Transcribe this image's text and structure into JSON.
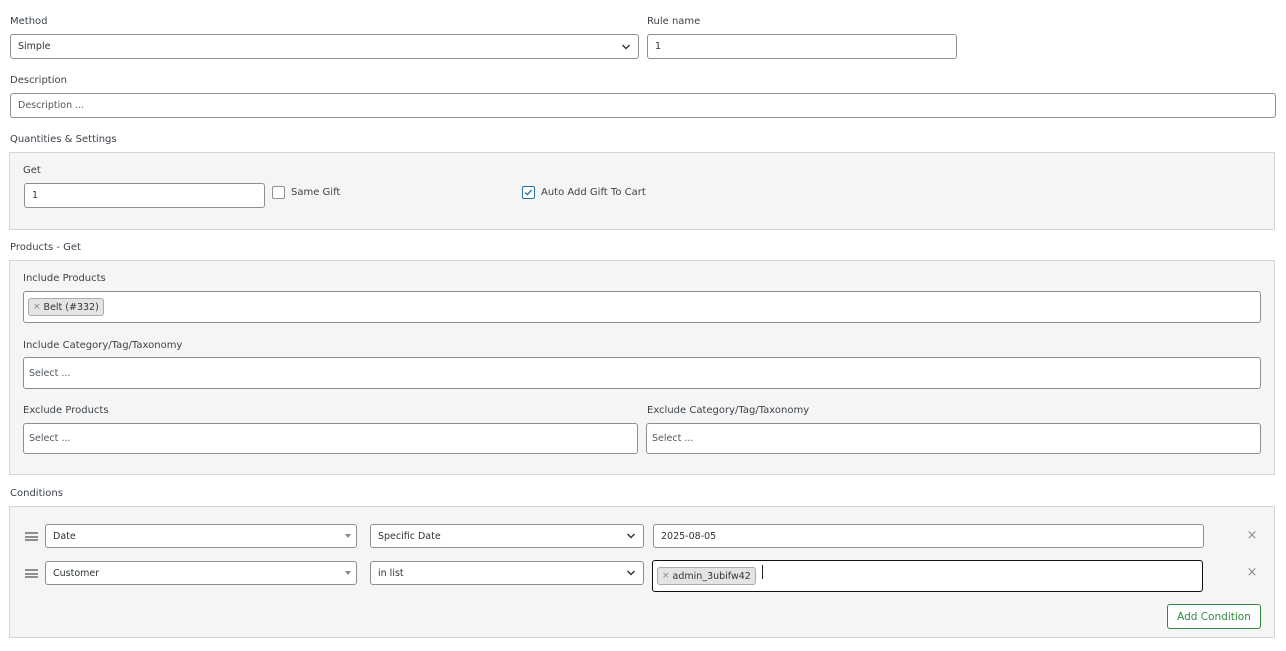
{
  "method": {
    "label": "Method",
    "value": "Simple"
  },
  "rule_name": {
    "label": "Rule name",
    "value": "1"
  },
  "description": {
    "label": "Description",
    "placeholder": "Description ..."
  },
  "quantities": {
    "label": "Quantities & Settings",
    "get_label": "Get",
    "get_value": "1",
    "same_gift_label": "Same Gift",
    "same_gift_checked": false,
    "auto_add_label": "Auto Add Gift To Cart",
    "auto_add_checked": true
  },
  "products_get": {
    "label": "Products - Get",
    "include_products_label": "Include Products",
    "include_products_tags": [
      "Belt (#332)"
    ],
    "include_category_label": "Include Category/Tag/Taxonomy",
    "include_category_placeholder": "Select ...",
    "exclude_products_label": "Exclude Products",
    "exclude_products_placeholder": "Select ...",
    "exclude_category_label": "Exclude Category/Tag/Taxonomy",
    "exclude_category_placeholder": "Select ..."
  },
  "conditions": {
    "label": "Conditions",
    "rows": [
      {
        "type": "Date",
        "operator": "Specific Date",
        "value": "2025-08-05"
      },
      {
        "type": "Customer",
        "operator": "in list",
        "tag": "admin_3ubifw42"
      }
    ],
    "add_label": "Add Condition"
  },
  "icons": {
    "remove": "×",
    "tag_remove": "×"
  },
  "colors": {
    "accent": "#2271b1",
    "add_button": "#2e8b3e",
    "panel_bg": "#f5f5f5"
  }
}
